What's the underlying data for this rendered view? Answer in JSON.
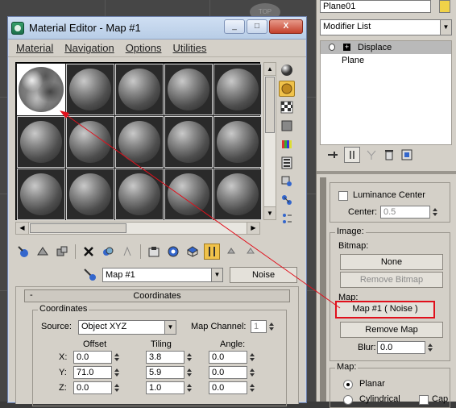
{
  "viewport": {
    "gizmo_label": "TOP"
  },
  "material_editor": {
    "title": "Material Editor - Map #1",
    "window_buttons": [
      "_",
      "□",
      "X"
    ],
    "menu": [
      "Material",
      "Navigation",
      "Options",
      "Utilities"
    ],
    "current_map_name": "Map #1",
    "map_type_button": "Noise",
    "rollout_title": "Coordinates",
    "rollout_toggle": "-",
    "coordinates": {
      "group_label": "Coordinates",
      "source_label": "Source:",
      "source_value": "Object XYZ",
      "map_channel_label": "Map Channel:",
      "map_channel_value": "1",
      "offset_header": "Offset",
      "tiling_header": "Tiling",
      "angle_header": "Angle:",
      "rows": [
        {
          "axis": "X:",
          "offset": "0.0",
          "tiling": "3.8",
          "angle": "0.0"
        },
        {
          "axis": "Y:",
          "offset": "71.0",
          "tiling": "5.9",
          "angle": "0.0"
        },
        {
          "axis": "Z:",
          "offset": "0.0",
          "tiling": "1.0",
          "angle": "0.0"
        }
      ]
    }
  },
  "command_panel": {
    "object_name": "Plane01",
    "modifier_list_label": "Modifier List",
    "stack": [
      {
        "label": "Displace"
      },
      {
        "label": "Plane"
      }
    ],
    "luminance_center_label": "Luminance Center",
    "center_label": "Center:",
    "center_value": "0.5",
    "image_group_label": "Image:",
    "bitmap_label": "Bitmap:",
    "bitmap_button": "None",
    "remove_bitmap_button": "Remove Bitmap",
    "map_label": "Map:",
    "map_button": "Map #1  ( Noise )",
    "remove_map_button": "Remove Map",
    "blur_label": "Blur:",
    "blur_value": "0.0",
    "map_group_label": "Map:",
    "planar_label": "Planar",
    "cylindrical_label": "Cylindrical",
    "cap_label": "Cap"
  },
  "colors": {
    "annotation_red": "#e0101c",
    "active_tool": "#f0c24a"
  }
}
